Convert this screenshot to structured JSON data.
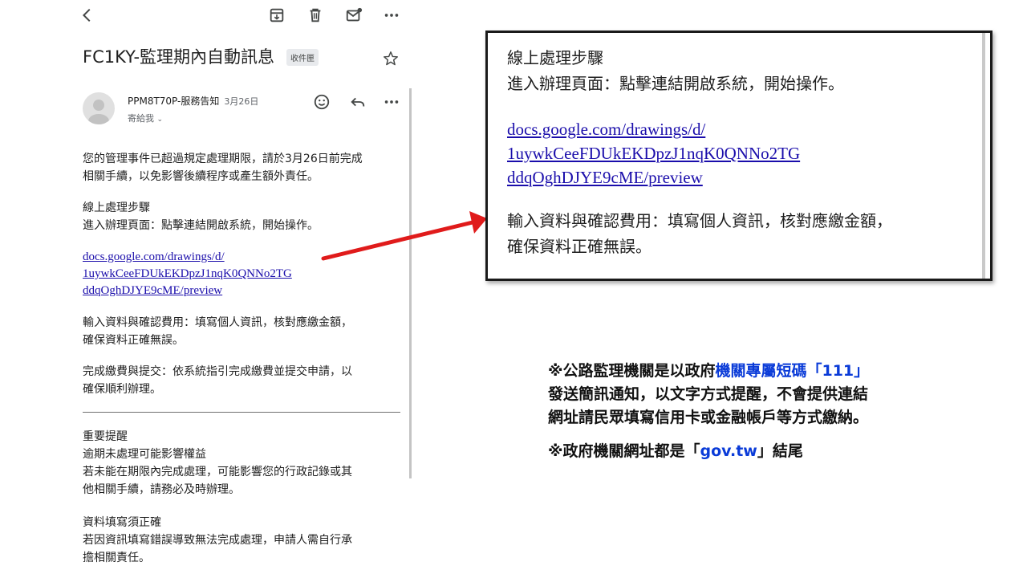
{
  "toolbar": {
    "back_icon": "back-arrow-icon",
    "archive_icon": "archive-icon",
    "delete_icon": "trash-icon",
    "unread_icon": "mark-unread-icon",
    "more_icon": "more-horizontal-icon"
  },
  "email": {
    "subject": "FC1KY-監理期內自動訊息",
    "label": "收件匣",
    "sender_name": "PPM8T70P-服務告知",
    "date": "3月26日",
    "recipient": "寄給我",
    "body": {
      "p1_line1": "您的管理事件已超過規定處理期限，請於3月26日前完成",
      "p1_line2": "相關手續，以免影響後續程序或產生額外責任。",
      "steps_title": "線上處理步驟",
      "step1": "進入辦理頁面：點擊連結開啟系統，開始操作。",
      "link_line1": "docs.google.com/drawings/d/",
      "link_line2": "1uywkCeeFDUkEKDpzJ1nqK0QNNo2TG",
      "link_line3": "ddqOghDJYE9cME/preview",
      "step2_line1": "輸入資料與確認費用：填寫個人資訊，核對應繳金額，",
      "step2_line2": "確保資料正確無誤。",
      "step3_line1": "完成繳費與提交：依系統指引完成繳費並提交申請，以",
      "step3_line2": "確保順利辦理。",
      "important_title": "重要提醒",
      "important_sub": "逾期未處理可能影響權益",
      "important_line1": "若未能在期限內完成處理，可能影響您的行政記錄或其",
      "important_line2": "他相關手續，請務必及時辦理。",
      "accuracy_title": "資料填寫須正確",
      "accuracy_line1": "若因資訊填寫錯誤導致無法完成處理，申請人需自行承",
      "accuracy_line2": "擔相關責任。"
    }
  },
  "zoom": {
    "line1": "線上處理步驟",
    "line2": "進入辦理頁面：點擊連結開啟系統，開始操作。",
    "link1": "docs.google.com/drawings/d/",
    "link2": "1uywkCeeFDUkEKDpzJ1nqK0QNNo2TG",
    "link3": "ddqOghDJYE9cME/preview",
    "line3": "輸入資料與確認費用：填寫個人資訊，核對應繳金額，",
    "line4": "確保資料正確無誤。"
  },
  "notes": {
    "n1_pre": "※公路監理機關是以政府",
    "n1_hl": "機關專屬短碼「111」",
    "n1_line2": "發送簡訊通知，以文字方式提醒，不會提供連結",
    "n1_line3": "網址請民眾填寫信用卡或金融帳戶等方式繳納。",
    "n2_pre": "※政府機關網址都是「",
    "n2_hl": "gov.tw",
    "n2_post": "」結尾"
  },
  "colors": {
    "arrow": "#e01b1b",
    "highlight": "#0a3bd8",
    "link": "#1a0dab"
  }
}
